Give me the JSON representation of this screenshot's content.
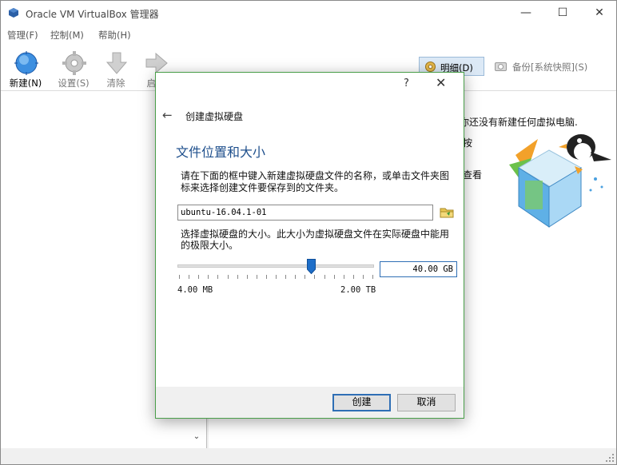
{
  "window": {
    "title": "Oracle VM VirtualBox 管理器",
    "minimize_glyph": "—",
    "maximize_glyph": "☐",
    "close_glyph": "✕"
  },
  "menu": [
    {
      "label": "管理(F)"
    },
    {
      "label": "控制(M)"
    },
    {
      "label": "帮助(H)"
    }
  ],
  "toolbar": {
    "new_label": "新建(N)",
    "settings_label": "设置(S)",
    "discard_label": "清除",
    "start_label": "启动",
    "details_label": "明细(D)",
    "snapshots_label": "备份[系统快照](S)"
  },
  "welcome": {
    "line1": "你还没有新建任何虚拟电脑.",
    "line2": "按",
    "line3": "查看"
  },
  "dialog": {
    "help_glyph": "?",
    "close_glyph": "✕",
    "back_glyph": "←",
    "heading": "创建虚拟硬盘",
    "subtitle": "文件位置和大小",
    "desc_file": "请在下面的框中键入新建虚拟硬盘文件的名称，或单击文件夹图标来选择创建文件要保存到的文件夹。",
    "file_value": "ubuntu-16.04.1-01",
    "desc_size": "选择虚拟硬盘的大小。此大小为虚拟硬盘文件在实际硬盘中能用的极限大小。",
    "size_value": "40.00 GB",
    "slider_fraction": 0.68,
    "scale_min": "4.00 MB",
    "scale_max": "2.00 TB",
    "create_label": "创建",
    "cancel_label": "取消"
  },
  "colors": {
    "dialog_border": "#4a9e4a",
    "subtitle": "#1e4f8c",
    "focus": "#2f6fb5",
    "details_bg": "#dce9f6"
  }
}
